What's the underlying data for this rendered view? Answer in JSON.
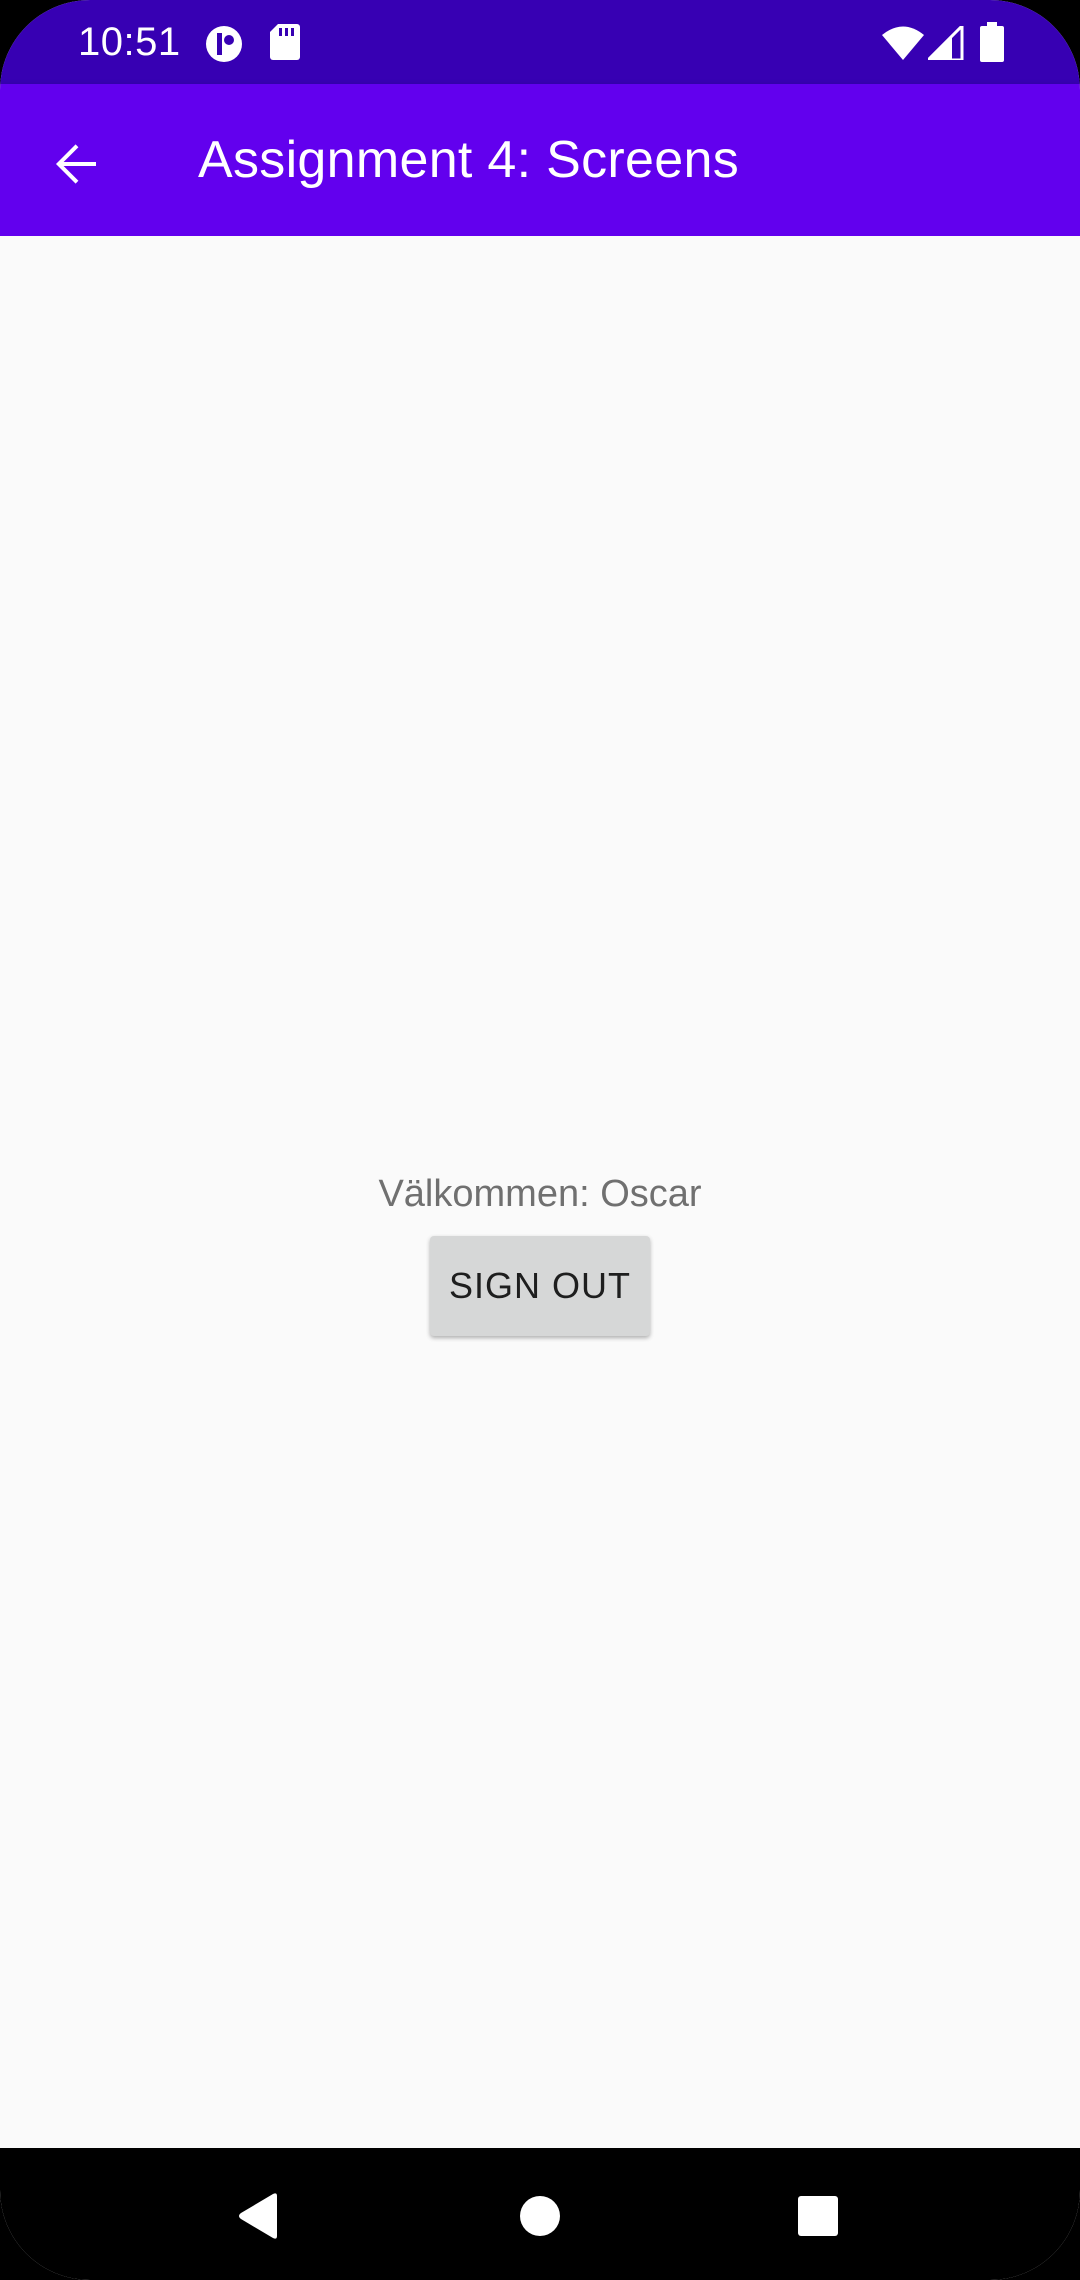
{
  "status_bar": {
    "time": "10:51",
    "left_icons": [
      "app-notification-icon",
      "sd-card-icon"
    ],
    "right_icons": [
      "wifi-icon",
      "cell-signal-icon",
      "battery-icon"
    ]
  },
  "app_bar": {
    "title": "Assignment 4: Screens",
    "back_icon": "arrow-back-icon"
  },
  "main": {
    "welcome_text": "Välkommen: Oscar",
    "sign_out_label": "SIGN OUT"
  },
  "nav_bar": {
    "icons": [
      "nav-back-icon",
      "nav-home-icon",
      "nav-recents-icon"
    ]
  },
  "colors": {
    "status_bar": "#3700b3",
    "app_bar": "#6200ee",
    "background": "#fafafa",
    "button": "#d6d7d7"
  }
}
